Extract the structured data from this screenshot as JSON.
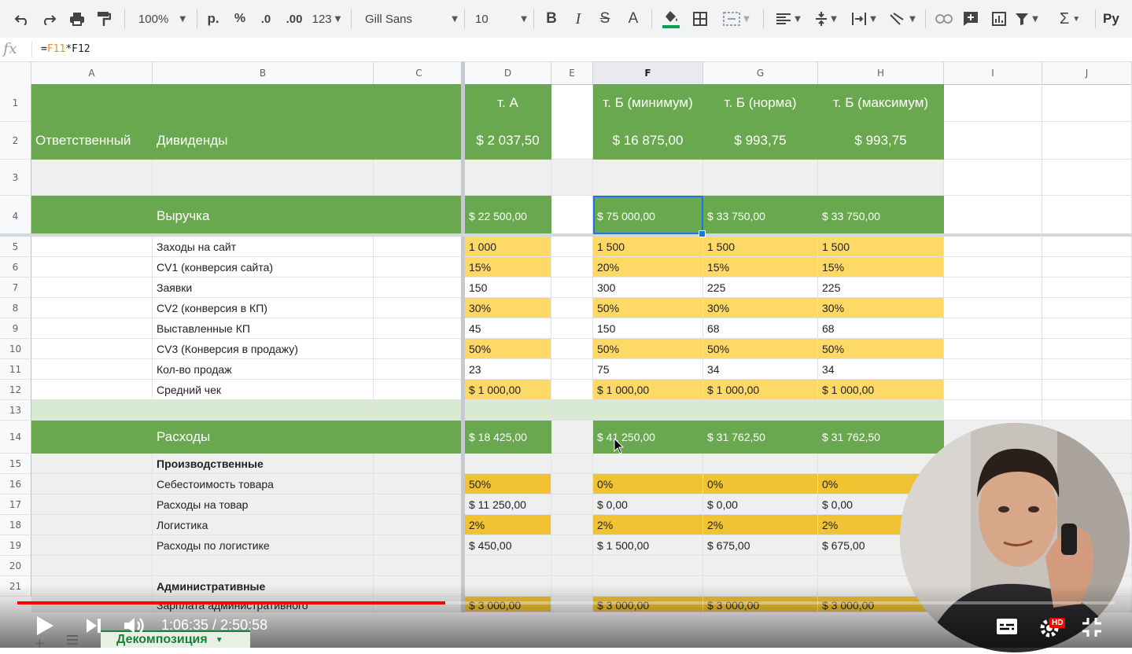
{
  "toolbar": {
    "zoom": "100%",
    "currency": "р.",
    "percent": "%",
    "dec_less": ".0",
    "dec_more": ".00",
    "more_formats": "123",
    "font": "Gill Sans",
    "font_size": "10",
    "lang_partial": "Ру"
  },
  "formula_bar": {
    "fx": "fx",
    "eq": "=",
    "ref1": "F11",
    "op": "*",
    "ref2": "F12"
  },
  "columns": [
    "A",
    "B",
    "C",
    "D",
    "E",
    "F",
    "G",
    "H",
    "I",
    "J"
  ],
  "rows": [
    "1",
    "2",
    "3",
    "4",
    "5",
    "6",
    "7",
    "8",
    "9",
    "10",
    "11",
    "12",
    "13",
    "14",
    "15",
    "16",
    "17",
    "18",
    "19",
    "20",
    "21"
  ],
  "header_block": {
    "a2": "Ответственный",
    "b2": "Дивиденды",
    "d1": "т. А",
    "f1": "т. Б (минимум)",
    "g1": "т. Б (норма)",
    "h1": "т. Б (максимум)",
    "d2": "$ 2 037,50",
    "f2": "$ 16 875,00",
    "g2": "$ 993,75",
    "h2": "$ 993,75"
  },
  "revenue": {
    "label": "Выручка",
    "d": "$ 22 500,00",
    "f": "$ 75 000,00",
    "g": "$ 33 750,00",
    "h": "$ 33 750,00"
  },
  "metrics": [
    {
      "label": "Заходы на сайт",
      "d": "1 000",
      "f": "1 500",
      "g": "1 500",
      "h": "1 500",
      "yellow": true
    },
    {
      "label": "CV1 (конверсия сайта)",
      "d": "15%",
      "f": "20%",
      "g": "15%",
      "h": "15%",
      "yellow": true
    },
    {
      "label": "Заявки",
      "d": "150",
      "f": "300",
      "g": "225",
      "h": "225",
      "yellow": false
    },
    {
      "label": "CV2 (конверсия в КП)",
      "d": "30%",
      "f": "50%",
      "g": "30%",
      "h": "30%",
      "yellow": true
    },
    {
      "label": "Выставленные КП",
      "d": "45",
      "f": "150",
      "g": "68",
      "h": "68",
      "yellow": false
    },
    {
      "label": "CV3 (Конверсия в продажу)",
      "d": "50%",
      "f": "50%",
      "g": "50%",
      "h": "50%",
      "yellow": true
    },
    {
      "label": "Кол-во продаж",
      "d": "23",
      "f": "75",
      "g": "34",
      "h": "34",
      "yellow": false
    },
    {
      "label": "Средний чек",
      "d": "$ 1 000,00",
      "f": "$ 1 000,00",
      "g": "$ 1 000,00",
      "h": "$ 1 000,00",
      "yellow": true
    }
  ],
  "expenses": {
    "label": "Расходы",
    "d": "$ 18 425,00",
    "f": "$ 41 250,00",
    "g": "$ 31 762,50",
    "h": "$ 31 762,50"
  },
  "production": [
    {
      "label": "Производственные",
      "d": "",
      "f": "",
      "g": "",
      "h": "",
      "bold": true,
      "yellow": false
    },
    {
      "label": "Себестоимость товара",
      "d": "50%",
      "f": "0%",
      "g": "0%",
      "h": "0%",
      "bold": false,
      "yellow": true
    },
    {
      "label": "Расходы на товар",
      "d": "$ 11 250,00",
      "f": "$ 0,00",
      "g": "$ 0,00",
      "h": "$ 0,00",
      "bold": false,
      "yellow": false
    },
    {
      "label": "Логистика",
      "d": "2%",
      "f": "2%",
      "g": "2%",
      "h": "2%",
      "bold": false,
      "yellow": true
    },
    {
      "label": "Расходы по логистике",
      "d": "$ 450,00",
      "f": "$ 1 500,00",
      "g": "$ 675,00",
      "h": "$ 675,00",
      "bold": false,
      "yellow": false
    },
    {
      "label": "",
      "d": "",
      "f": "",
      "g": "",
      "h": "",
      "bold": false,
      "yellow": false
    },
    {
      "label": "Административные",
      "d": "",
      "f": "",
      "g": "",
      "h": "",
      "bold": true,
      "yellow": false
    }
  ],
  "partial_row": {
    "label": "Зарплата административного",
    "d": "$ 3 000,00",
    "f": "$ 3 000,00",
    "g": "$ 3 000,00",
    "h": "$ 3 000,00"
  },
  "video": {
    "time": "1:06:35 / 2:50:58",
    "progress": 0.39,
    "hd_badge": "HD"
  },
  "sheet_tab": {
    "name": "Декомпозиция"
  },
  "colors": {
    "green": "#6aa84f",
    "yellow": "#ffd966",
    "light_green": "#d9ead3",
    "selection": "#1a73e8",
    "progress": "#ff0000"
  }
}
